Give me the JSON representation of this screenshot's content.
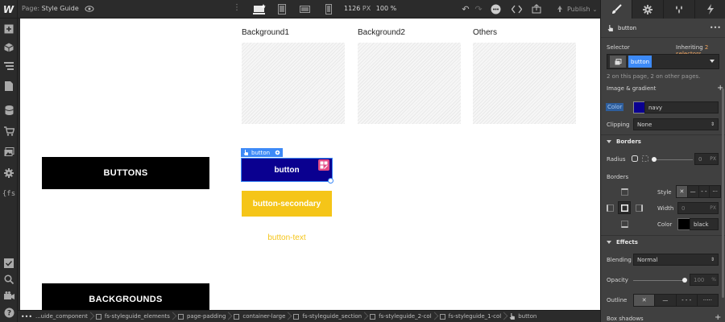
{
  "app": {
    "logo": "W"
  },
  "topbar": {
    "page_prefix": "Page:",
    "page_name": "Style Guide",
    "width_value": "1126",
    "width_unit": "PX",
    "zoom": "100 %",
    "publish_label": "Publish"
  },
  "canvas": {
    "columns": [
      "Background1",
      "Background2",
      "Others"
    ],
    "sections": {
      "buttons": "BUTTONS",
      "backgrounds": "BACKGROUNDS"
    },
    "selection_tag": "button",
    "buttons": {
      "primary": "button",
      "secondary": "button-secondary",
      "text": "button-text"
    },
    "colors": {
      "primary_bg": "#0a0090",
      "secondary_bg": "#f5c518",
      "selection": "#3d8af7"
    }
  },
  "breadcrumbs": [
    {
      "label": "...uide_component",
      "icon": "component-box"
    },
    {
      "label": "fs-styleguide_elements",
      "icon": "box"
    },
    {
      "label": "page-padding",
      "icon": "box"
    },
    {
      "label": "container-large",
      "icon": "box"
    },
    {
      "label": "fs-styleguide_section",
      "icon": "box"
    },
    {
      "label": "fs-styleguide_2-col",
      "icon": "box"
    },
    {
      "label": "fs-styleguide_1-col",
      "icon": "box"
    },
    {
      "label": "button",
      "icon": "hand"
    }
  ],
  "panel": {
    "header_name": "button",
    "selector_label": "Selector",
    "inheriting_label": "Inheriting",
    "inheriting_count": "2 selectors",
    "selector_chip": "button",
    "usage_note": "2 on this page, 2 on other pages.",
    "image_gradient_label": "Image & gradient",
    "color_label": "Color",
    "color_value": "navy",
    "clipping_label": "Clipping",
    "clipping_value": "None",
    "borders_section": "Borders",
    "radius_label": "Radius",
    "radius_value": "0",
    "radius_unit": "PX",
    "borders_label": "Borders",
    "style_label": "Style",
    "width_label": "Width",
    "width_value": "0",
    "width_unit": "PX",
    "border_color_label": "Color",
    "border_color_value": "black",
    "effects_section": "Effects",
    "blending_label": "Blending",
    "blending_value": "Normal",
    "opacity_label": "Opacity",
    "opacity_value": "100",
    "opacity_unit": "%",
    "outline_label": "Outline",
    "box_shadows_label": "Box shadows"
  }
}
